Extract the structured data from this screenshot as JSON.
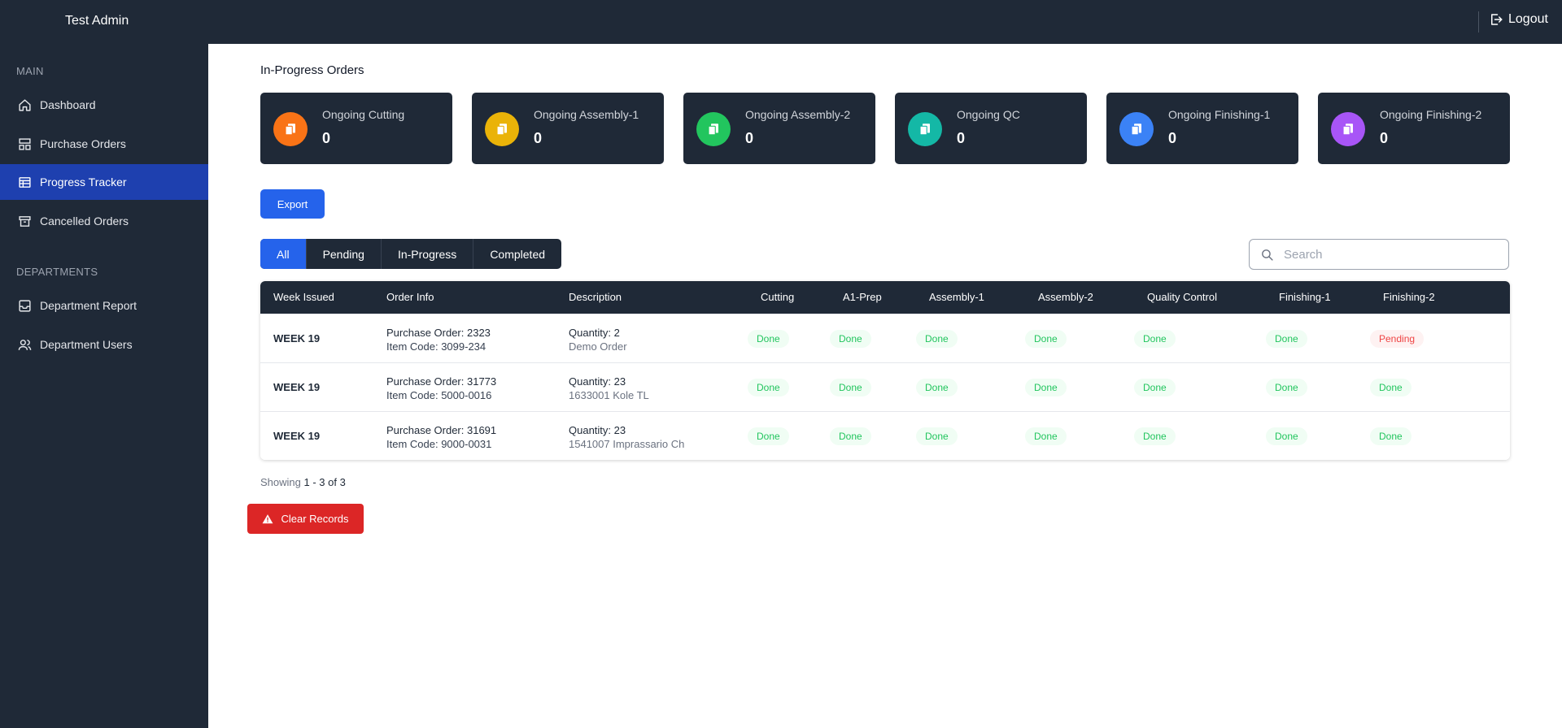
{
  "topbar": {
    "brand": "Test Admin",
    "logout_label": "Logout"
  },
  "sidebar": {
    "section_main": "MAIN",
    "section_departments": "DEPARTMENTS",
    "items": [
      {
        "label": "Dashboard",
        "icon": "home-icon"
      },
      {
        "label": "Purchase Orders",
        "icon": "layout-icon"
      },
      {
        "label": "Progress Tracker",
        "icon": "table-icon",
        "active": true
      },
      {
        "label": "Cancelled Orders",
        "icon": "archive-icon"
      },
      {
        "label": "Department Report",
        "icon": "inbox-icon"
      },
      {
        "label": "Department Users",
        "icon": "users-icon"
      }
    ]
  },
  "main": {
    "section_title": "In-Progress Orders",
    "stats": [
      {
        "label": "Ongoing Cutting",
        "value": "0",
        "color": "#f97316"
      },
      {
        "label": "Ongoing Assembly-1",
        "value": "0",
        "color": "#eab308"
      },
      {
        "label": "Ongoing Assembly-2",
        "value": "0",
        "color": "#22c55e"
      },
      {
        "label": "Ongoing QC",
        "value": "0",
        "color": "#14b8a6"
      },
      {
        "label": "Ongoing Finishing-1",
        "value": "0",
        "color": "#3b82f6"
      },
      {
        "label": "Ongoing Finishing-2",
        "value": "0",
        "color": "#a855f7"
      }
    ],
    "export_label": "Export",
    "filters": [
      "All",
      "Pending",
      "In-Progress",
      "Completed"
    ],
    "active_filter": "All",
    "search": {
      "placeholder": "Search",
      "value": ""
    },
    "table": {
      "headers": [
        "Week Issued",
        "Order Info",
        "Description",
        "Cutting",
        "A1-Prep",
        "Assembly-1",
        "Assembly-2",
        "Quality Control",
        "Finishing-1",
        "Finishing-2"
      ],
      "rows": [
        {
          "week": "WEEK 19",
          "po": "Purchase Order: 2323",
          "item": "Item Code: 3099-234",
          "qty": "Quantity: 2",
          "desc": "Demo Order",
          "statuses": [
            "Done",
            "Done",
            "Done",
            "Done",
            "Done",
            "Done",
            "Pending"
          ]
        },
        {
          "week": "WEEK 19",
          "po": "Purchase Order: 31773",
          "item": "Item Code: 5000-0016",
          "qty": "Quantity: 23",
          "desc": "1633001 Kole TL",
          "statuses": [
            "Done",
            "Done",
            "Done",
            "Done",
            "Done",
            "Done",
            "Done"
          ]
        },
        {
          "week": "WEEK 19",
          "po": "Purchase Order: 31691",
          "item": "Item Code: 9000-0031",
          "qty": "Quantity: 23",
          "desc": "1541007 Imprassario Ch",
          "statuses": [
            "Done",
            "Done",
            "Done",
            "Done",
            "Done",
            "Done",
            "Done"
          ]
        }
      ]
    },
    "showing": {
      "prefix": "Showing ",
      "range": "1 - 3 of 3"
    },
    "clear_label": "Clear Records"
  }
}
